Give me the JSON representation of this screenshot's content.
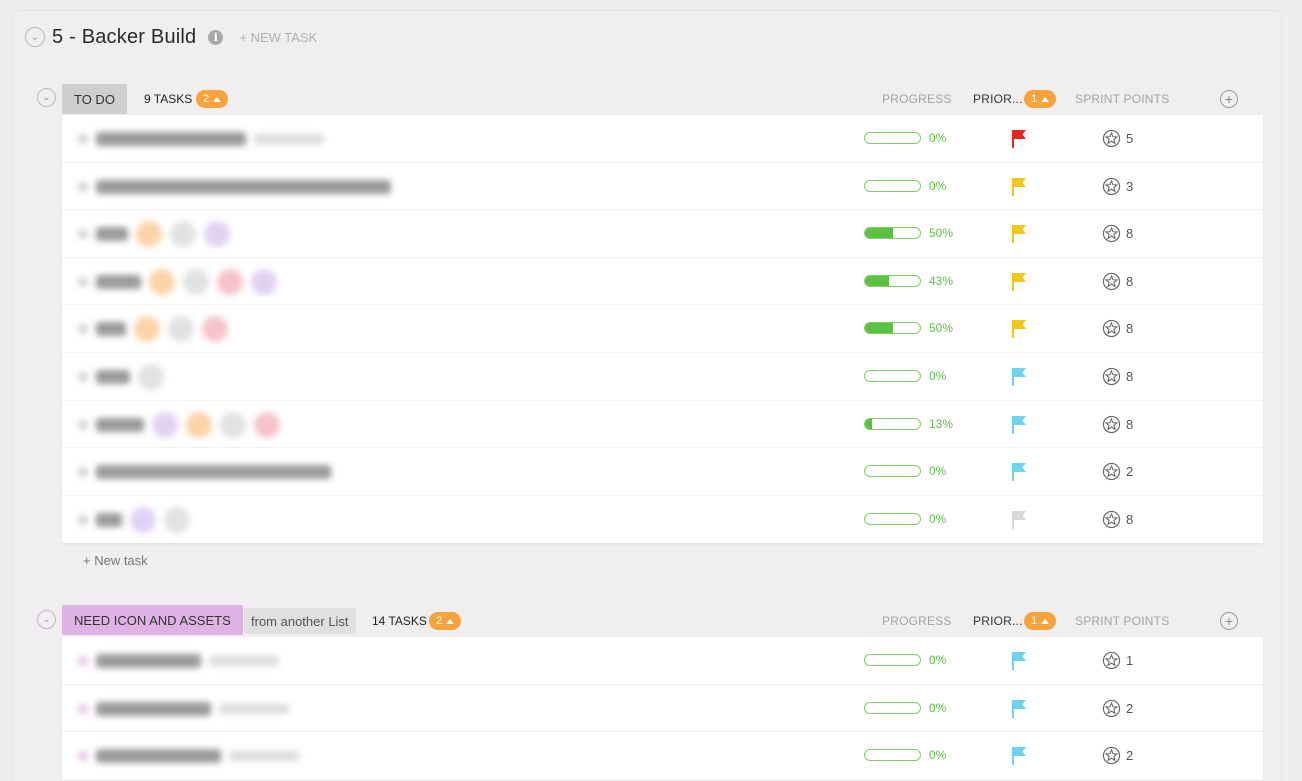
{
  "list": {
    "title": "5 - Backer Build",
    "new_task_label": "+ NEW TASK",
    "info_glyph": "i"
  },
  "columns": {
    "progress": "PROGRESS",
    "priority": "PRIOR...",
    "sprint_points": "SPRINT POINTS",
    "add_glyph": "+"
  },
  "groups": [
    {
      "status": "TO DO",
      "status_color": "#cfcfcf",
      "task_count": "9 TASKS",
      "badge": "2",
      "priority_badge": "1",
      "new_task_label": "+ New task",
      "tasks": [
        {
          "progress_pct": 0,
          "progress_label": "0%",
          "priority_color": "#e8261e",
          "points": "5"
        },
        {
          "progress_pct": 0,
          "progress_label": "0%",
          "priority_color": "#f5c518",
          "points": "3"
        },
        {
          "progress_pct": 50,
          "progress_label": "50%",
          "priority_color": "#f5c518",
          "points": "8"
        },
        {
          "progress_pct": 43,
          "progress_label": "43%",
          "priority_color": "#f5c518",
          "points": "8"
        },
        {
          "progress_pct": 50,
          "progress_label": "50%",
          "priority_color": "#f5c518",
          "points": "8"
        },
        {
          "progress_pct": 0,
          "progress_label": "0%",
          "priority_color": "#6fd3ef",
          "points": "8"
        },
        {
          "progress_pct": 13,
          "progress_label": "13%",
          "priority_color": "#6fd3ef",
          "points": "8"
        },
        {
          "progress_pct": 0,
          "progress_label": "0%",
          "priority_color": "#6fd3ef",
          "points": "2"
        },
        {
          "progress_pct": 0,
          "progress_label": "0%",
          "priority_color": "#d8d8d8",
          "points": "8"
        }
      ]
    },
    {
      "status": "NEED ICON AND ASSETS",
      "status_color": "#deb3e3",
      "from_list": "from another List",
      "task_count": "14 TASKS",
      "badge": "2",
      "priority_badge": "1",
      "tasks": [
        {
          "progress_pct": 0,
          "progress_label": "0%",
          "priority_color": "#6fd3ef",
          "points": "1"
        },
        {
          "progress_pct": 0,
          "progress_label": "0%",
          "priority_color": "#6fd3ef",
          "points": "2"
        },
        {
          "progress_pct": 0,
          "progress_label": "0%",
          "priority_color": "#6fd3ef",
          "points": "2"
        }
      ]
    }
  ]
}
